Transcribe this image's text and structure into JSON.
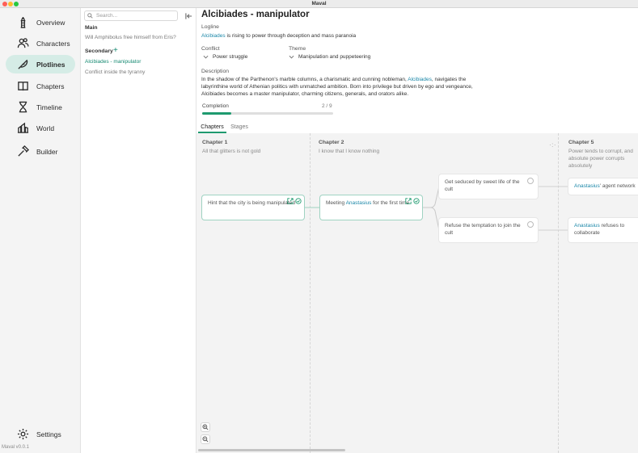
{
  "window": {
    "title": "Maval"
  },
  "nav": {
    "items": [
      {
        "label": "Overview",
        "icon": "tower-icon"
      },
      {
        "label": "Characters",
        "icon": "characters-icon"
      },
      {
        "label": "Plotlines",
        "icon": "quill-icon",
        "active": true
      },
      {
        "label": "Chapters",
        "icon": "chapters-icon"
      },
      {
        "label": "Timeline",
        "icon": "hourglass-icon"
      },
      {
        "label": "World",
        "icon": "world-icon"
      },
      {
        "label": "Builder",
        "icon": "builder-icon"
      }
    ],
    "settings_label": "Settings",
    "version": "Maval v0.0.1"
  },
  "plotlines": {
    "search_placeholder": "Search...",
    "main_title": "Main",
    "main_items": [
      "Will Amphibolus free himself from Eris?"
    ],
    "secondary_title": "Secondary",
    "secondary_items": [
      "Alcibiades - manipulator",
      "Conflict inside the tyranny"
    ]
  },
  "detail": {
    "title": "Alcibiades - manipulator",
    "logline_label": "Logline",
    "logline_link": "Alcibiades",
    "logline_rest": " is rising to power through deception and mass paranoia",
    "conflict_label": "Conflict",
    "conflict_value": "Power struggle",
    "theme_label": "Theme",
    "theme_value": "Manipulation and puppeteering",
    "description_label": "Description",
    "description_part1": "In the shadow of the Parthenon's marble columns, a charismatic and cunning nobleman, ",
    "description_link": "Alcibiades",
    "description_part2": ", navigates the labyrinthine world of Athenian politics with unmatched ambition. Born into privilege but driven by ego and vengeance, Alcibiades becomes a master manipulator, charming citizens, generals, and orators alike.",
    "completion_label": "Completion",
    "completion_count": "2 / 9",
    "completion_fraction": 0.222
  },
  "tabs": [
    "Chapters",
    "Stages"
  ],
  "board": {
    "columns": [
      {
        "title": "Chapter 1",
        "subtitle": "All that glitters is not gold"
      },
      {
        "title": "Chapter 2",
        "subtitle": "I know that I know nothing"
      },
      {
        "title": "Chapter 5",
        "subtitle": "Power tends to corrupt, and absolute power corrupts absolutely"
      }
    ],
    "cards": {
      "c1": "Hint that the city is being manipulated",
      "c2_pre": "Meeting ",
      "c2_link": "Anastasius",
      "c2_post": " for the first time",
      "c3": "Get seduced by sweet life of the cult",
      "c4": "Refuse the temptation to join the cult",
      "c5_link": "Anastasius",
      "c5_post": "' agent network",
      "c6_link": "Anastasius",
      "c6_post": " refuses to collaborate"
    }
  }
}
